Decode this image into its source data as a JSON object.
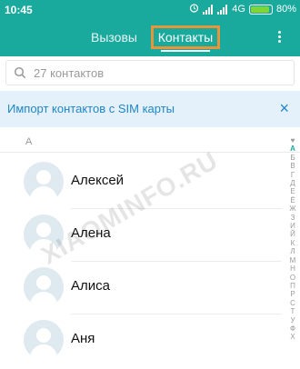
{
  "status_bar": {
    "time": "10:45",
    "network": "4G",
    "battery": "80%",
    "battery_level": 0.8,
    "icons": [
      "alarm-icon",
      "signal-icon",
      "signal-icon",
      "network-type",
      "battery-icon"
    ]
  },
  "tabs": {
    "calls": "Вызовы",
    "contacts": "Контакты",
    "active": "contacts"
  },
  "search": {
    "placeholder": "27 контактов"
  },
  "import_banner": {
    "text": "Импорт контактов с SIM карты",
    "close": "×"
  },
  "section_header": "А",
  "contacts": [
    {
      "name": "Алексей"
    },
    {
      "name": "Алена"
    },
    {
      "name": "Алиса"
    },
    {
      "name": "Аня"
    }
  ],
  "alphabet": [
    "♥",
    "А",
    "Б",
    "В",
    "Г",
    "Д",
    "Е",
    "Ё",
    "Ж",
    "З",
    "И",
    "Й",
    "К",
    "Л",
    "М",
    "Н",
    "О",
    "П",
    "Р",
    "С",
    "Т",
    "У",
    "Ф",
    "Х"
  ],
  "watermark": "XIAOMINFO.RU",
  "colors": {
    "accent": "#1aa99d",
    "highlight": "#e8953a",
    "banner_bg": "#e5f1fa",
    "banner_text": "#1e86c9"
  }
}
